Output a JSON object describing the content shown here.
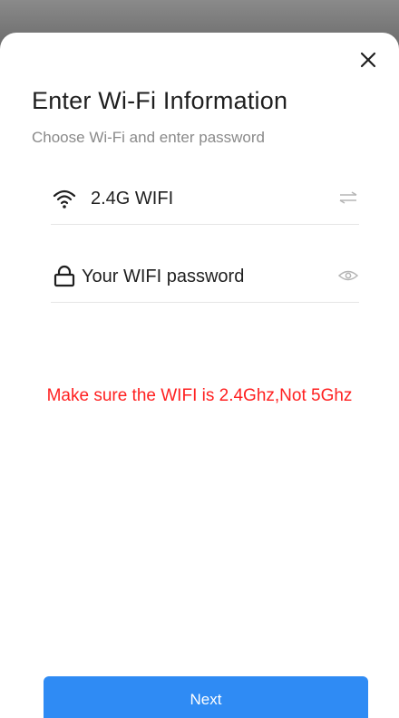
{
  "modal": {
    "title": "Enter Wi-Fi Information",
    "subtitle": "Choose Wi-Fi and enter password"
  },
  "wifi": {
    "network_name": "2.4G WIFI",
    "icon": "wifi-icon",
    "action_icon": "switch-network-icon"
  },
  "password": {
    "placeholder": "Your WIFI password",
    "icon": "lock-icon",
    "action_icon": "eye-icon"
  },
  "warning": {
    "text": "Make sure the WIFI is 2.4Ghz,Not 5Ghz",
    "color": "#ff2020"
  },
  "actions": {
    "next_label": "Next",
    "close_icon": "close-icon"
  },
  "colors": {
    "accent": "#2f8bf4",
    "overlay": "#6e6e6e"
  }
}
